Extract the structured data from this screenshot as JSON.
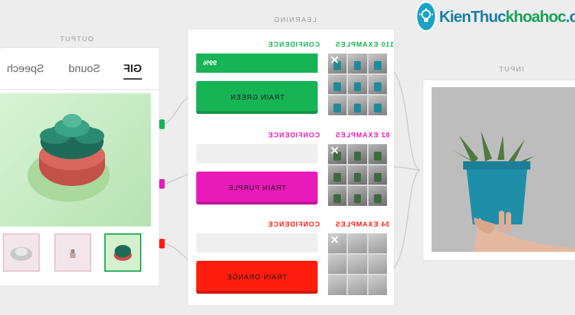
{
  "watermark": {
    "text_part1": "KienThuc",
    "text_part2": "khoahoc",
    "text_part3": ".org",
    "icon": "lightbulb-icon"
  },
  "output": {
    "title": "OUTPUT",
    "tabs": [
      {
        "label": "GIF",
        "active": true
      },
      {
        "label": "Sound",
        "active": false
      },
      {
        "label": "Speech",
        "active": false
      }
    ]
  },
  "learning": {
    "title": "LEARNING",
    "classes": [
      {
        "examples": "110 EXAMPLES",
        "confidence_label": "CONFIDENCE",
        "confidence_value": "99%",
        "confidence": 1.0,
        "button": "TRAIN GREEN",
        "color": "#16b455"
      },
      {
        "examples": "82 EXAMPLES",
        "confidence_label": "CONFIDENCE",
        "confidence_value": "",
        "confidence": 0,
        "button": "TRAIN PURPLE",
        "color": "#e81ab8"
      },
      {
        "examples": "34 EXAMPLES",
        "confidence_label": "CONFIDENCE",
        "confidence_value": "",
        "confidence": 0,
        "button": "TRAIN ORANGE",
        "color": "#ff1d0f"
      }
    ]
  },
  "input": {
    "title": "INPUT"
  },
  "colors": {
    "green": "#16b455",
    "purple": "#e81ab8",
    "orange": "#ff1d0f",
    "bg": "#ededed"
  }
}
